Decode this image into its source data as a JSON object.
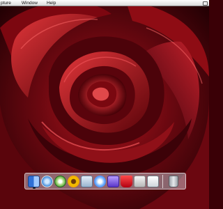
{
  "menubar": {
    "items": [
      "pture",
      "Window",
      "Help"
    ]
  },
  "desktop": {
    "wallpaper": "red-rose",
    "colors": {
      "rose_dark": "#2a0004",
      "rose_mid": "#8c0a12",
      "rose_light": "#d82a30",
      "menubar": "#ececec"
    }
  },
  "dock": {
    "icons": [
      "finder-icon",
      "safari-icon",
      "itunes-icon",
      "iphoto-icon",
      "mail-icon",
      "ichat-icon",
      "imovie-icon",
      "system-preferences-icon",
      "preview-icon",
      "disk-utility-icon",
      "trash-icon"
    ]
  }
}
